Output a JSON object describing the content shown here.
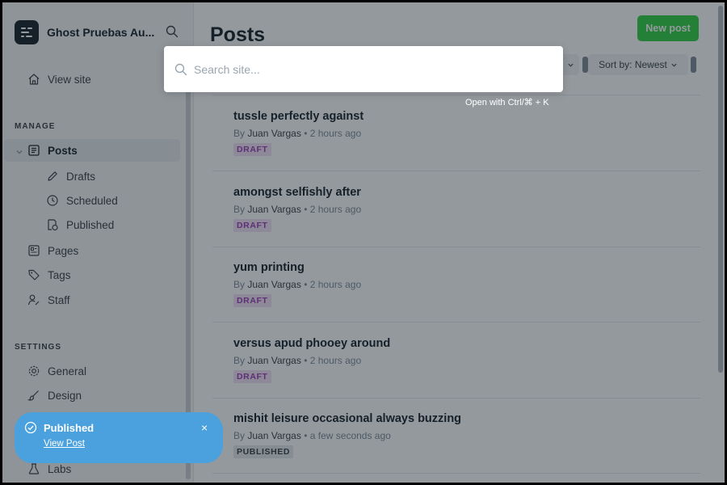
{
  "app": {
    "site_title": "Ghost Pruebas Au..."
  },
  "sidebar": {
    "view_site": "View site",
    "manage_label": "MANAGE",
    "posts": "Posts",
    "drafts": "Drafts",
    "scheduled": "Scheduled",
    "published": "Published",
    "pages": "Pages",
    "tags": "Tags",
    "staff": "Staff",
    "settings_label": "SETTINGS",
    "general": "General",
    "design": "Design",
    "labs": "Labs"
  },
  "main": {
    "title": "Posts",
    "new_post": "New post",
    "sort": "Sort by: Newest"
  },
  "posts": [
    {
      "title": "tussle perfectly against",
      "author": "Juan Vargas",
      "time": "2 hours ago",
      "status": "DRAFT"
    },
    {
      "title": "amongst selfishly after",
      "author": "Juan Vargas",
      "time": "2 hours ago",
      "status": "DRAFT"
    },
    {
      "title": "yum printing",
      "author": "Juan Vargas",
      "time": "2 hours ago",
      "status": "DRAFT"
    },
    {
      "title": "versus apud phooey around",
      "author": "Juan Vargas",
      "time": "2 hours ago",
      "status": "DRAFT"
    },
    {
      "title": "mishit leisure occasional always buzzing",
      "author": "Juan Vargas",
      "time": "a few seconds ago",
      "status": "PUBLISHED"
    }
  ],
  "meta_by": "By",
  "meta_sep": "•",
  "search": {
    "placeholder": "Search site...",
    "value": "",
    "hint": "Open with Ctrl/⌘ + K"
  },
  "toast": {
    "title": "Published",
    "link": "View Post",
    "close": "×"
  },
  "colors": {
    "accent_green": "#30cf43",
    "toast_blue": "#4ba1de",
    "draft_pink": "#9b3cb3"
  }
}
